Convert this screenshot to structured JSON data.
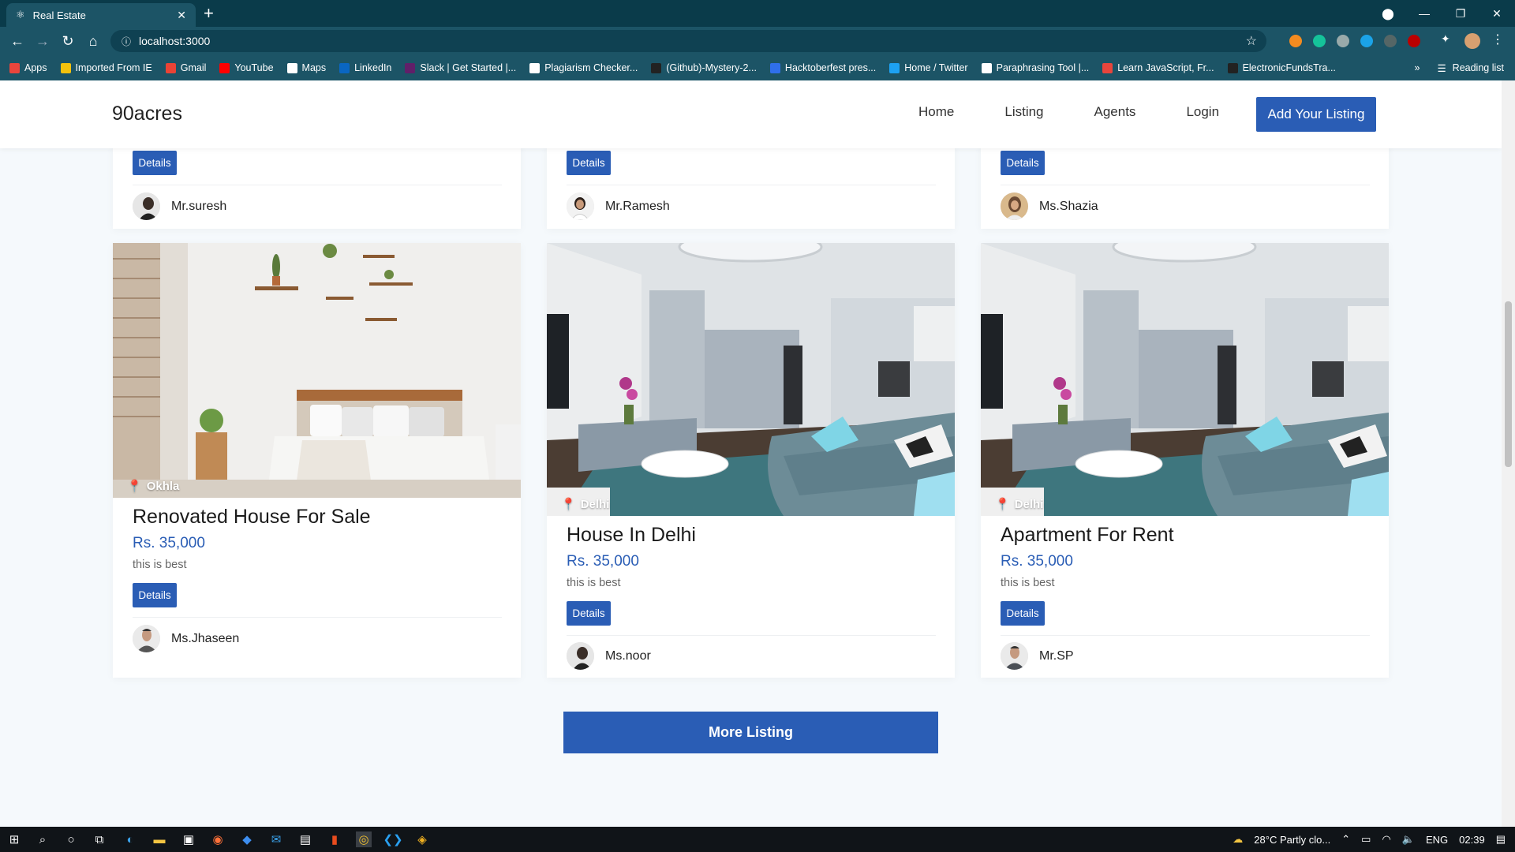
{
  "browser": {
    "tab_title": "Real Estate",
    "url": "localhost:3000",
    "bookmarks": [
      {
        "label": "Apps",
        "color": "#e8453c"
      },
      {
        "label": "Imported From IE",
        "color": "#f4c20d"
      },
      {
        "label": "Gmail",
        "color": "#ea4335"
      },
      {
        "label": "YouTube",
        "color": "#ff0000"
      },
      {
        "label": "Maps",
        "color": "#ffffff"
      },
      {
        "label": "LinkedIn",
        "color": "#0a66c2"
      },
      {
        "label": "Slack | Get Started |...",
        "color": "#611f69"
      },
      {
        "label": "Plagiarism Checker...",
        "color": "#ffffff"
      },
      {
        "label": "(Github)-Mystery-2...",
        "color": "#222222"
      },
      {
        "label": "Hacktoberfest pres...",
        "color": "#2f6fea"
      },
      {
        "label": "Home / Twitter",
        "color": "#1da1f2"
      },
      {
        "label": "Paraphrasing Tool |...",
        "color": "#ffffff"
      },
      {
        "label": "Learn JavaScript, Fr...",
        "color": "#e8453c"
      },
      {
        "label": "ElectronicFundsTra...",
        "color": "#222222"
      }
    ],
    "reading_list": "Reading list"
  },
  "site": {
    "brand": "90acres",
    "nav": [
      "Home",
      "Listing",
      "Agents",
      "Login"
    ],
    "cta": "Add Your Listing",
    "more_button": "More Listing",
    "details_label": "Details"
  },
  "top_cards": [
    {
      "agent": "Mr.suresh"
    },
    {
      "agent": "Mr.Ramesh"
    },
    {
      "agent": "Ms.Shazia"
    }
  ],
  "listings": [
    {
      "location": "Okhla",
      "title": "Renovated House For Sale",
      "price": "Rs. 35,000",
      "description": "this is best",
      "agent": "Ms.Jhaseen",
      "image": "bedroom"
    },
    {
      "location": "Delhi",
      "title": "House In Delhi",
      "price": "Rs. 35,000",
      "description": "this is best",
      "agent": "Ms.noor",
      "image": "living-room"
    },
    {
      "location": "Delhi",
      "title": "Apartment For Rent",
      "price": "Rs. 35,000",
      "description": "this is best",
      "agent": "Mr.SP",
      "image": "living-room"
    }
  ],
  "taskbar": {
    "weather": "28°C  Partly clo...",
    "lang": "ENG",
    "time": "02:39"
  },
  "colors": {
    "accent": "#2a5db5",
    "chrome": "#1c5466"
  }
}
